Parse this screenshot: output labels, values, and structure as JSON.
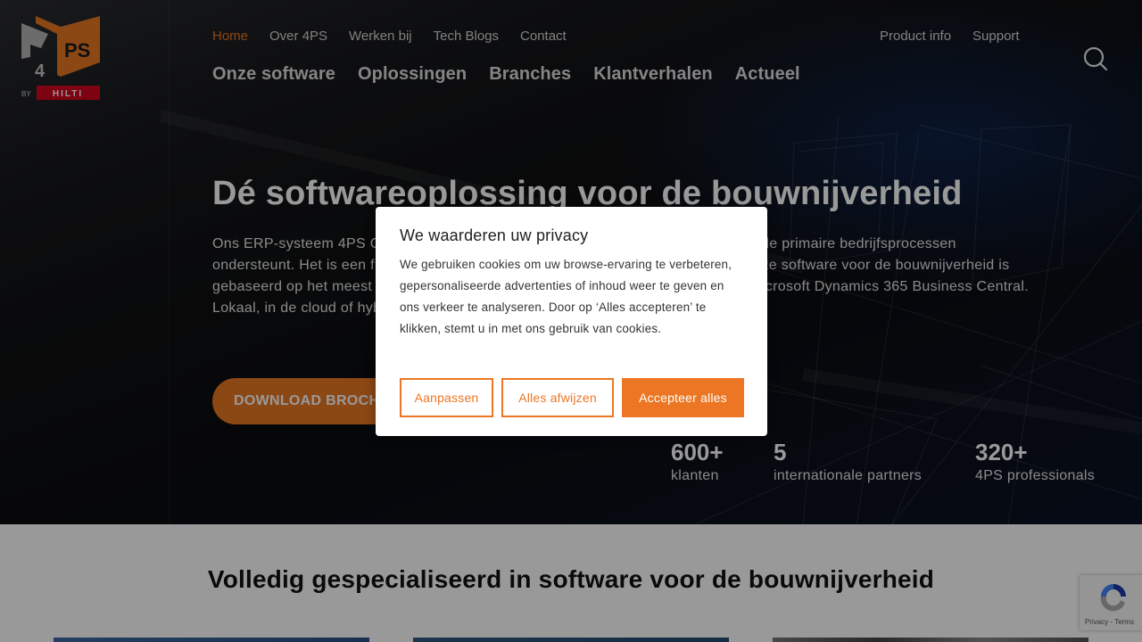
{
  "header": {
    "logo": {
      "brand": "4PS",
      "by_label": "BY",
      "parent_brand": "HILTI"
    },
    "top_nav": [
      {
        "label": "Home",
        "active": true
      },
      {
        "label": "Over 4PS",
        "active": false
      },
      {
        "label": "Werken bij",
        "active": false
      },
      {
        "label": "Tech Blogs",
        "active": false
      },
      {
        "label": "Contact",
        "active": false
      }
    ],
    "main_nav": [
      {
        "label": "Onze software"
      },
      {
        "label": "Oplossingen"
      },
      {
        "label": "Branches"
      },
      {
        "label": "Klantverhalen"
      },
      {
        "label": "Actueel"
      }
    ],
    "util_nav": [
      {
        "label": "Product info"
      },
      {
        "label": "Support"
      }
    ],
    "search_icon": "search-icon"
  },
  "hero": {
    "title": "Dé softwareoplossing voor de bouwnijverheid",
    "text": "Ons ERP-systeem 4PS Construct is een complete en geïntegreerde oplossing die alle primaire bedrijfsprocessen ondersteunt. Het is een flexibele, innovatieve en toekomstbestendige applicatie. Onze software voor de bouwnijverheid is gebaseerd op het meest toonaangevende ERP-softwareplatform van dit moment: Microsoft Dynamics 365 Business Central. Lokaal, in de cloud of hybride beschikbaar. Altijd up-to-date, schaalbaar én veilig.",
    "cta_label": "DOWNLOAD BROCHURE",
    "stats": [
      {
        "value": "600+",
        "label": "klanten"
      },
      {
        "value": "5",
        "label": "internationale partners"
      },
      {
        "value": "320+",
        "label": "4PS professionals"
      }
    ]
  },
  "section": {
    "title": "Volledig gespecialiseerd in software voor de bouwnijverheid"
  },
  "cookie_dialog": {
    "title": "We waarderen uw privacy",
    "body": "We gebruiken cookies om uw browse-ervaring te verbeteren, gepersonaliseerde advertenties of inhoud weer te geven en ons verkeer te analyseren. Door op ‘Alles accepteren’ te klikken, stemt u in met ons gebruik van cookies.",
    "buttons": {
      "customize": "Aanpassen",
      "reject": "Alles afwijzen",
      "accept": "Accepteer alles"
    }
  },
  "recaptcha": {
    "links": "Privacy - Terms"
  },
  "colors": {
    "brand_orange": "#e87722",
    "cookie_orange": "#ec7623",
    "hilti_red": "#d2051e"
  }
}
